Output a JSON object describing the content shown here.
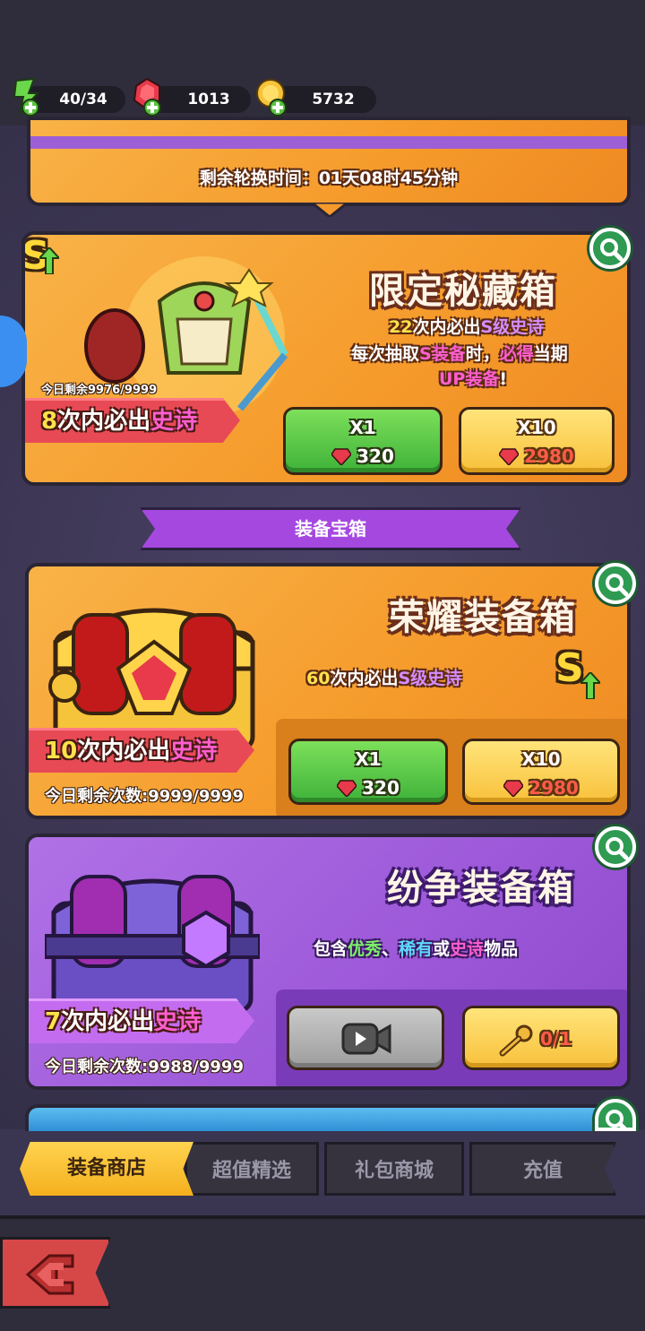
{
  "resources": {
    "energy": "40/34",
    "gems": "1013",
    "coins": "5732"
  },
  "rotation": {
    "label": "剩余轮换时间：01天08时45分钟"
  },
  "limited_box": {
    "title": "限定秘藏箱",
    "line1_count": "22",
    "line1_mid": "次内必出",
    "line1_grade": "S级史诗",
    "line2_pre": "每次抽取",
    "line2_grade": "S装备",
    "line2_post": "时，",
    "line2_hl": "必得",
    "line2_end": "当期",
    "line3_hl": "UP装备",
    "line3_end": "!",
    "daily_remaining": "今日剩余9976/9999",
    "ribbon_num": "8",
    "ribbon_text": "次内必出",
    "ribbon_hl": "史诗",
    "x1_label": "X1",
    "x1_price": "320",
    "x10_label": "X10",
    "x10_price": "2980",
    "badge": "S"
  },
  "section_header": "装备宝箱",
  "glory_box": {
    "title": "荣耀装备箱",
    "line_count": "60",
    "line_mid": "次内必出",
    "line_grade": "S级史诗",
    "ribbon_num": "10",
    "ribbon_text": "次内必出",
    "ribbon_hl": "史诗",
    "daily_remaining": "今日剩余次数:9999/9999",
    "x1_label": "X1",
    "x1_price": "320",
    "x10_label": "X10",
    "x10_price": "2980",
    "badge": "S"
  },
  "dispute_box": {
    "title": "纷争装备箱",
    "line_pre": "包含",
    "line_a": "优秀",
    "line_sep": "、",
    "line_b": "稀有",
    "line_or": "或",
    "line_c": "史诗",
    "line_end": "物品",
    "ribbon_num": "7",
    "ribbon_text": "次内必出",
    "ribbon_hl": "史诗",
    "daily_remaining": "今日剩余次数:9988/9999",
    "key_count": "0/1"
  },
  "tabs": [
    {
      "label": "装备商店"
    },
    {
      "label": "超值精选"
    },
    {
      "label": "礼包商城"
    },
    {
      "label": "充值"
    }
  ],
  "colors": {
    "orange_panel": "#f59a2b",
    "purple_panel": "#9c58d8",
    "accent_yellow": "#ffd34f",
    "gem_red": "#e83a4a"
  }
}
